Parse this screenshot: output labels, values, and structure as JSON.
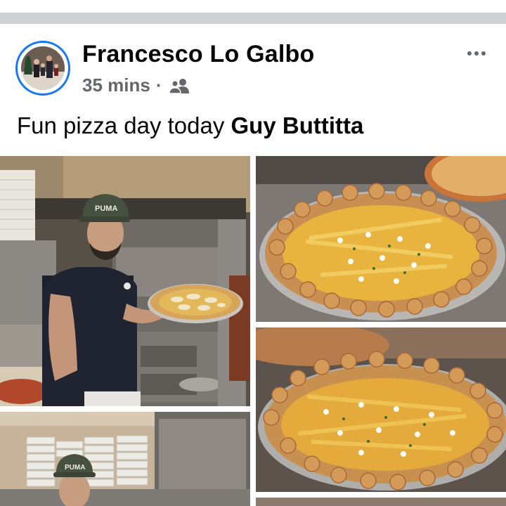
{
  "post": {
    "author": "Francesco Lo Galbo",
    "time": "35 mins",
    "separator": "·",
    "privacy_icon": "friends-icon",
    "caption_text": "Fun pizza day today ",
    "caption_tag": "Guy Buttitta"
  },
  "photos": {
    "cap_text": "PUMA",
    "count": 5
  },
  "colors": {
    "accent": "#1877f2",
    "meta": "#65676b",
    "divider": "#d0d1d5"
  }
}
